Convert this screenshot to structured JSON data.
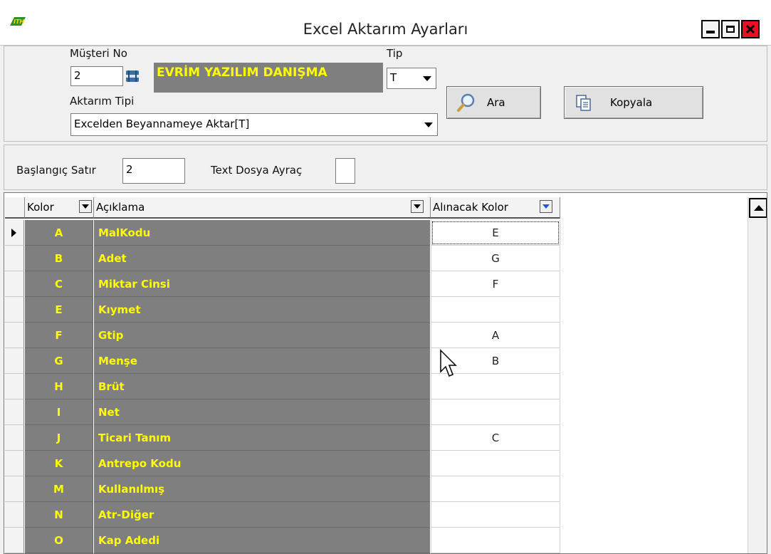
{
  "window": {
    "title": "Excel Aktarım Ayarları"
  },
  "form": {
    "customer_no_label": "Müşteri No",
    "customer_no_value": "2",
    "customer_name": "EVRİM YAZILIM DANIŞMA",
    "type_label": "Tip",
    "type_value": "T",
    "transfer_type_label": "Aktarım Tipi",
    "transfer_type_value": "Excelden Beyannameye Aktar[T]",
    "search_button": "Ara",
    "copy_button": "Kopyala",
    "start_row_label": "Başlangıç Satır",
    "start_row_value": "2",
    "text_separator_label": "Text Dosya Ayraç",
    "text_separator_value": ""
  },
  "grid": {
    "columns": {
      "column": "Kolor",
      "description": "Açıklama",
      "take_column": "Alınacak Kolor"
    },
    "rows": [
      {
        "col": "A",
        "desc": "MalKodu",
        "take": "E"
      },
      {
        "col": "B",
        "desc": "Adet",
        "take": "G"
      },
      {
        "col": "C",
        "desc": "Miktar Cinsi",
        "take": "F"
      },
      {
        "col": "E",
        "desc": "Kıymet",
        "take": ""
      },
      {
        "col": "F",
        "desc": "Gtip",
        "take": "A"
      },
      {
        "col": "G",
        "desc": "Menşe",
        "take": "B"
      },
      {
        "col": "H",
        "desc": "Brüt",
        "take": ""
      },
      {
        "col": "I",
        "desc": "Net",
        "take": ""
      },
      {
        "col": "J",
        "desc": "Ticari Tanım",
        "take": "C"
      },
      {
        "col": "K",
        "desc": "Antrepo Kodu",
        "take": ""
      },
      {
        "col": "M",
        "desc": "Kullanılmış",
        "take": ""
      },
      {
        "col": "N",
        "desc": "Atr-Diğer",
        "take": ""
      },
      {
        "col": "O",
        "desc": "Kap Adedi",
        "take": ""
      }
    ]
  },
  "colors": {
    "cell_gray": "#7f7f7f",
    "cell_text_yellow": "#ffff00",
    "close_red": "#e81123"
  }
}
